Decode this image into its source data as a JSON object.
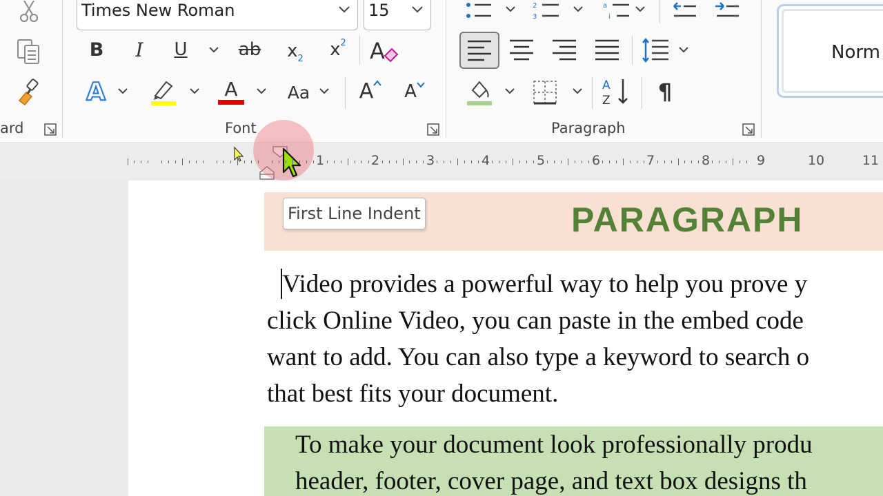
{
  "ribbon": {
    "clipboard": {
      "label_fragment": "ard"
    },
    "font": {
      "label": "Font",
      "font_name": "Times New Roman",
      "font_size": "15",
      "buttons": {
        "bold": "B",
        "italic": "I",
        "underline": "U",
        "strikethrough": "ab",
        "subscript_base": "x",
        "subscript_mark": "2",
        "superscript_base": "x",
        "superscript_mark": "2",
        "clear_formatting": "A",
        "text_effects": "A",
        "font_color": "A",
        "change_case": "Aa",
        "grow_font": "A",
        "shrink_font": "A"
      },
      "highlight_color": "#ffff00",
      "font_color_bar": "#e00000"
    },
    "paragraph": {
      "label": "Paragraph",
      "show_marks": "¶",
      "shading_bar": "#a9d18e"
    },
    "styles": {
      "normal_label": "Norm"
    }
  },
  "ruler": {
    "numbers": [
      "1",
      "2",
      "3",
      "4",
      "5",
      "6",
      "7",
      "8",
      "9",
      "10",
      "11"
    ]
  },
  "document": {
    "tooltip": "First Line Indent",
    "heading": "PARAGRAPH",
    "heading_color": "#538135",
    "paragraph1_lines": [
      "Video provides a powerful way to help you prove y",
      "click Online Video, you can paste in the embed code",
      "want to add. You can also type a keyword to search o",
      "that best fits your document."
    ],
    "paragraph2_lines": [
      "To make your document look professionally produ",
      "header, footer, cover page, and text box designs th"
    ]
  }
}
